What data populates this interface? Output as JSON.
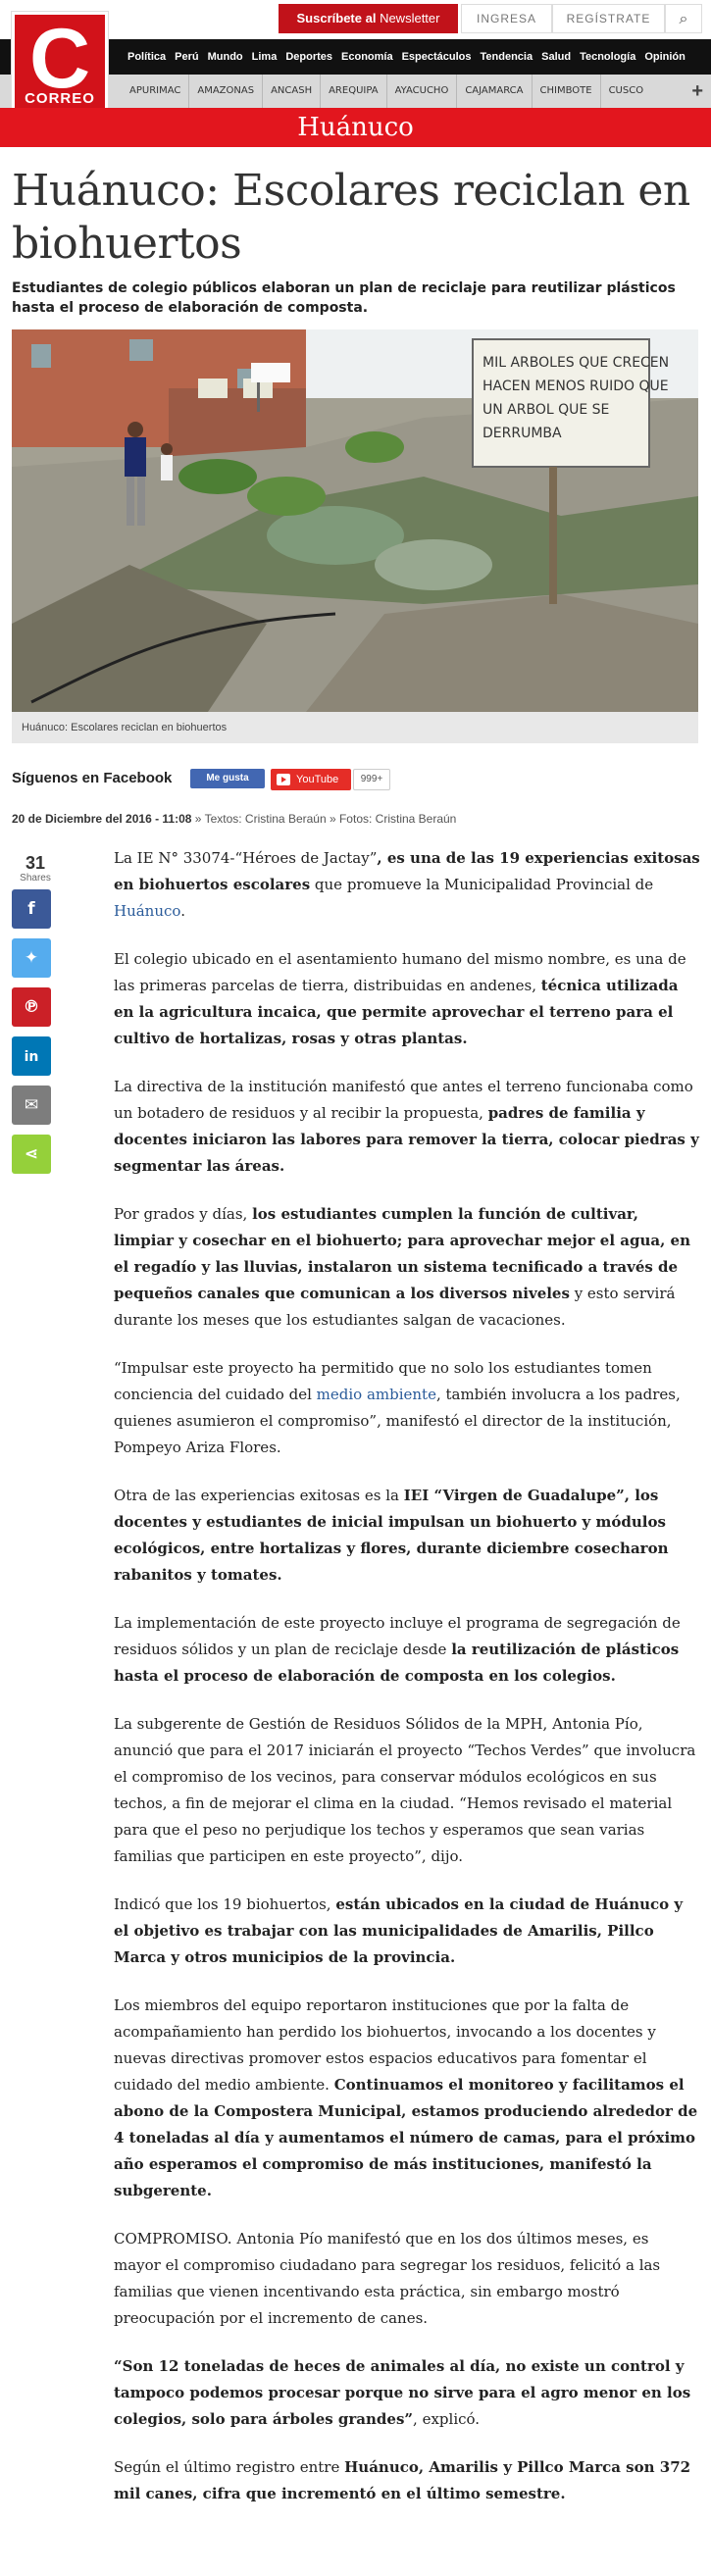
{
  "header": {
    "logo_letter": "C",
    "logo_word": "CORREO",
    "subscribe_strong": "Suscríbete al",
    "subscribe_rest": " Newsletter",
    "login": "INGRESA",
    "register": "REGÍSTRATE",
    "search_icon": "magnifier"
  },
  "nav_main": [
    "Política",
    "Perú",
    "Mundo",
    "Lima",
    "Deportes",
    "Economía",
    "Espectáculos",
    "Tendencia",
    "Salud",
    "Tecnología",
    "Opinión"
  ],
  "nav_regions": [
    "APURIMAC",
    "AMAZONAS",
    "ANCASH",
    "AREQUIPA",
    "AYACUCHO",
    "CAJAMARCA",
    "CHIMBOTE",
    "CUSCO"
  ],
  "section": "Huánuco",
  "article": {
    "title": "Huánuco: Escolares reciclan en biohuertos",
    "lead": "Estudiantes de colegio públicos elaboran un plan de reciclaje para reutilizar plásticos hasta el proceso de elaboración de composta.",
    "sign_text": "MIL ARBOLES QUE CRECEN HACEN MENOS RUIDO QUE UN ARBOL QUE SE DERRUMBA",
    "caption": "Huánuco: Escolares reciclan en biohuertos",
    "follow": "Síguenos en Facebook",
    "fb_like": "Me gusta",
    "youtube": "YouTube",
    "yt_count": "999+",
    "date": "20 de Diciembre del 2016 - 11:08",
    "byline_rest": " » Textos: Cristina Beraún » Fotos: Cristina Beraún",
    "shares_count": "31",
    "shares_label": "Shares"
  },
  "paragraphs": {
    "p1a": "La IE N° 33074-“Héroes de Jactay”",
    "p1b": ", es una de las 19 experiencias exitosas en biohuertos escolares",
    "p1c": " que promueve la Municipalidad Provincial de ",
    "p1d": "Huánuco",
    "p1e": ".",
    "p2a": "El colegio ubicado en el asentamiento humano del mismo nombre, es una de las primeras parcelas de tierra, distribuidas en andenes, ",
    "p2b": "técnica utilizada en la agricultura incaica, que permite aprovechar el terreno para el cultivo de hortalizas, rosas y otras plantas.",
    "p3a": "La directiva de la institución manifestó que antes el terreno funcionaba como un botadero de residuos y al recibir la propuesta, ",
    "p3b": "padres de familia y docentes iniciaron las labores para remover la tierra, colocar piedras y segmentar las áreas.",
    "p4a": "Por grados y días, ",
    "p4b": "los estudiantes cumplen la función de cultivar, limpiar y cosechar en el biohuerto; para aprovechar mejor el agua, en el regadío y las lluvias, instalaron un sistema tecnificado a través de pequeños canales que comunican a los diversos niveles",
    "p4c": " y esto servirá durante los meses que los estudiantes salgan de vacaciones.",
    "p5a": "“Impulsar este proyecto ha permitido que no solo los estudiantes tomen conciencia del cuidado del ",
    "p5b": "medio ambiente",
    "p5c": ", también involucra a los padres, quienes asumieron el compromiso”, manifestó el director de la institución, Pompeyo Ariza Flores.",
    "p6a": "Otra de las experiencias exitosas es la ",
    "p6b": "IEI “Virgen de Guadalupe”, los docentes y estudiantes de inicial impulsan un biohuerto y módulos ecológicos, entre hortalizas y flores, durante diciembre cosecharon rabanitos y tomates.",
    "p7a": "La implementación de este proyecto incluye el programa de segregación de residuos sólidos y un plan de reciclaje desde ",
    "p7b": "la reutilización de plásticos hasta el proceso de elaboración de composta en los colegios.",
    "p8": "La subgerente de Gestión de Residuos Sólidos de la MPH, Antonia Pío, anunció que para el 2017 iniciarán el proyecto “Techos Verdes” que involucra el compromiso de los vecinos, para conservar módulos ecológicos en sus techos, a fin de mejorar el clima en la ciudad. “Hemos revisado el material para que el peso no perjudique los techos y esperamos que sean varias familias que participen en este proyecto”, dijo.",
    "p9a": "Indicó que los 19 biohuertos, ",
    "p9b": "están ubicados en la ciudad de Huánuco y el objetivo es trabajar con las municipalidades de Amarilis, Pillco Marca y otros municipios de la provincia.",
    "p10a": "Los miembros del equipo reportaron instituciones que por la falta de acompañamiento han perdido los biohuertos, invocando a los docentes y nuevas directivas promover estos espacios educativos para fomentar el cuidado del medio ambiente. ",
    "p10b": "Continuamos el monitoreo y facilitamos el abono de la Compostera Municipal, estamos produciendo alrededor de 4 toneladas al día y aumentamos el número de camas, para el próximo año esperamos el compromiso de más instituciones, manifestó la subgerente.",
    "p11": "COMPROMISO. Antonia Pío manifestó que en los dos últimos meses, es mayor el compromiso ciudadano para segregar los residuos, felicitó a las familias que vienen incentivando esta práctica, sin embargo mostró preocupación por el incremento de canes.",
    "p12a": "“Son 12 toneladas de heces de animales al día, no existe un control y tampoco podemos procesar porque no sirve para el agro menor en los colegios, solo para árboles grandes”",
    "p12b": ", explicó.",
    "p13a": "Según el último registro entre ",
    "p13b": "Huánuco, Amarilis y Pillco Marca son 372 mil canes, cifra que incrementó en el último semestre."
  },
  "share_buttons": [
    {
      "name": "facebook",
      "color": "#3b5998"
    },
    {
      "name": "twitter",
      "color": "#55acee"
    },
    {
      "name": "pinterest",
      "color": "#cb2027"
    },
    {
      "name": "linkedin",
      "color": "#0077b5"
    },
    {
      "name": "email",
      "color": "#7d7d7d"
    },
    {
      "name": "share",
      "color": "#95d03a"
    }
  ]
}
